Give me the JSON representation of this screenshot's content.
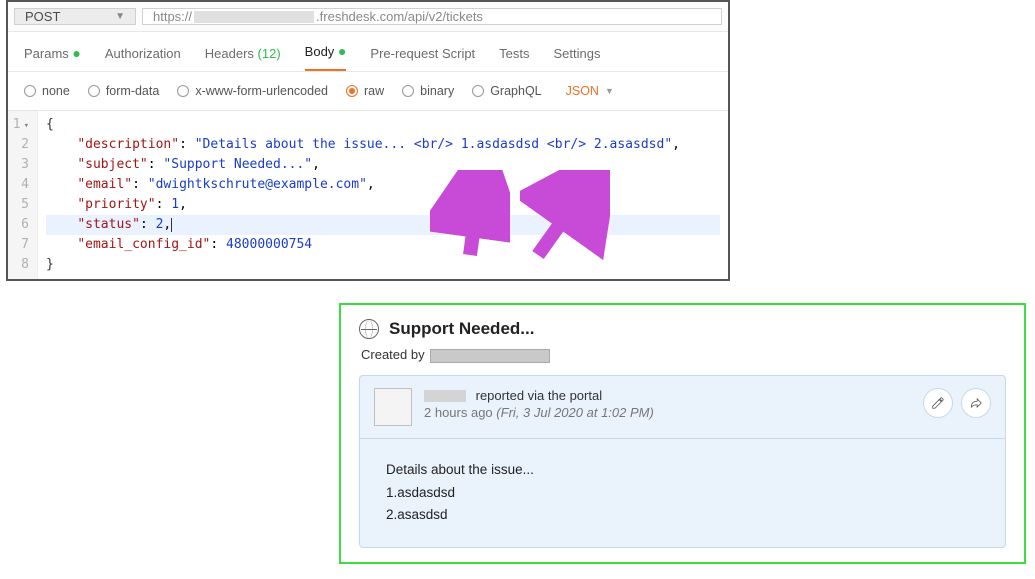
{
  "request": {
    "method": "POST",
    "url_prefix": "https://",
    "url_suffix": ".freshdesk.com/api/v2/tickets"
  },
  "tabs": {
    "params": "Params",
    "auth": "Authorization",
    "headers_label": "Headers",
    "headers_count": "(12)",
    "body": "Body",
    "prereq": "Pre-request Script",
    "tests": "Tests",
    "settings": "Settings"
  },
  "body_types": {
    "none": "none",
    "form_data": "form-data",
    "urlencoded": "x-www-form-urlencoded",
    "raw": "raw",
    "binary": "binary",
    "graphql": "GraphQL",
    "content_type": "JSON"
  },
  "code_lines": {
    "l1": "{",
    "l2_k": "\"description\"",
    "l2_v": "\"Details about the issue... <br/> 1.asdasdsd <br/> 2.asasdsd\"",
    "l3_k": "\"subject\"",
    "l3_v": "\"Support Needed...\"",
    "l4_k": "\"email\"",
    "l4_v": "\"dwightkschrute@example.com\"",
    "l5_k": "\"priority\"",
    "l5_v": "1",
    "l6_k": "\"status\"",
    "l6_v": "2",
    "l7_k": "\"email_config_id\"",
    "l7_v": "48000000754",
    "l8": "}"
  },
  "ticket": {
    "title": "Support Needed...",
    "created_by_label": "Created by",
    "reported_via": "reported via the portal",
    "time_rel": "2 hours ago",
    "time_abs": "(Fri, 3 Jul 2020 at 1:02 PM)",
    "body_line1": "Details about the issue...",
    "body_line2": "1.asdasdsd",
    "body_line3": "2.asasdsd"
  }
}
